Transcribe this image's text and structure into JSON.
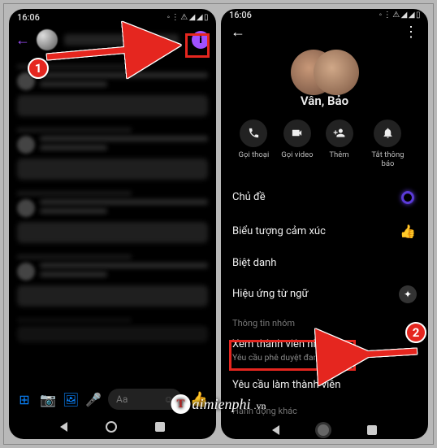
{
  "status": {
    "time": "16:06",
    "icons": "◦ ⋮  ⚠ ◢ ◢ ▯"
  },
  "left": {
    "composer_placeholder": "Aa"
  },
  "right": {
    "group_name": "Vân, Bảo",
    "actions": {
      "call": {
        "label": "Gọi thoại",
        "icon": "phone-icon"
      },
      "video": {
        "label": "Gọi video",
        "icon": "video-icon"
      },
      "add": {
        "label": "Thêm",
        "icon": "plus-user-icon"
      },
      "mute": {
        "label": "Tắt thông báo",
        "icon": "bell-icon"
      }
    },
    "rows": {
      "theme": "Chủ đề",
      "emoji": "Biểu tượng cảm xúc",
      "nickname": "Biệt danh",
      "effects": "Hiệu ứng từ ngữ",
      "section_info": "Thông tin nhóm",
      "members": {
        "title": "Xem thành viên nhóm",
        "sub": "Yêu cầu phê duyệt đang tắt"
      },
      "request": "Yêu cầu làm thành viên",
      "section_other": "Hành động khác"
    }
  },
  "annotations": {
    "badge1": "1",
    "badge2": "2"
  },
  "watermark": {
    "t": "T",
    "rest": "aimienphi",
    "vn": ".vn"
  }
}
